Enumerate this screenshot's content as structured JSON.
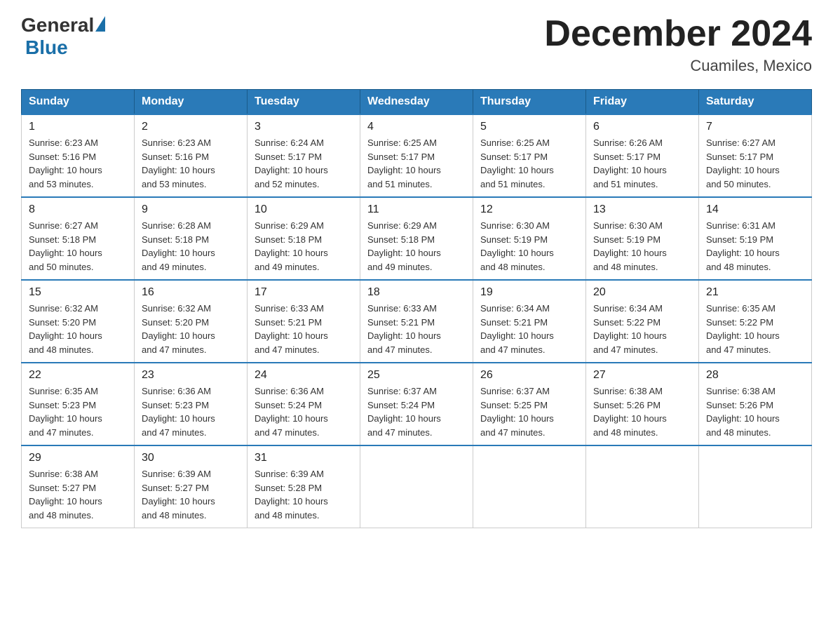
{
  "logo": {
    "general": "General",
    "blue": "Blue"
  },
  "title": "December 2024",
  "location": "Cuamiles, Mexico",
  "days_of_week": [
    "Sunday",
    "Monday",
    "Tuesday",
    "Wednesday",
    "Thursday",
    "Friday",
    "Saturday"
  ],
  "weeks": [
    [
      {
        "day": "1",
        "sunrise": "6:23 AM",
        "sunset": "5:16 PM",
        "daylight": "10 hours and 53 minutes."
      },
      {
        "day": "2",
        "sunrise": "6:23 AM",
        "sunset": "5:16 PM",
        "daylight": "10 hours and 53 minutes."
      },
      {
        "day": "3",
        "sunrise": "6:24 AM",
        "sunset": "5:17 PM",
        "daylight": "10 hours and 52 minutes."
      },
      {
        "day": "4",
        "sunrise": "6:25 AM",
        "sunset": "5:17 PM",
        "daylight": "10 hours and 51 minutes."
      },
      {
        "day": "5",
        "sunrise": "6:25 AM",
        "sunset": "5:17 PM",
        "daylight": "10 hours and 51 minutes."
      },
      {
        "day": "6",
        "sunrise": "6:26 AM",
        "sunset": "5:17 PM",
        "daylight": "10 hours and 51 minutes."
      },
      {
        "day": "7",
        "sunrise": "6:27 AM",
        "sunset": "5:17 PM",
        "daylight": "10 hours and 50 minutes."
      }
    ],
    [
      {
        "day": "8",
        "sunrise": "6:27 AM",
        "sunset": "5:18 PM",
        "daylight": "10 hours and 50 minutes."
      },
      {
        "day": "9",
        "sunrise": "6:28 AM",
        "sunset": "5:18 PM",
        "daylight": "10 hours and 49 minutes."
      },
      {
        "day": "10",
        "sunrise": "6:29 AM",
        "sunset": "5:18 PM",
        "daylight": "10 hours and 49 minutes."
      },
      {
        "day": "11",
        "sunrise": "6:29 AM",
        "sunset": "5:18 PM",
        "daylight": "10 hours and 49 minutes."
      },
      {
        "day": "12",
        "sunrise": "6:30 AM",
        "sunset": "5:19 PM",
        "daylight": "10 hours and 48 minutes."
      },
      {
        "day": "13",
        "sunrise": "6:30 AM",
        "sunset": "5:19 PM",
        "daylight": "10 hours and 48 minutes."
      },
      {
        "day": "14",
        "sunrise": "6:31 AM",
        "sunset": "5:19 PM",
        "daylight": "10 hours and 48 minutes."
      }
    ],
    [
      {
        "day": "15",
        "sunrise": "6:32 AM",
        "sunset": "5:20 PM",
        "daylight": "10 hours and 48 minutes."
      },
      {
        "day": "16",
        "sunrise": "6:32 AM",
        "sunset": "5:20 PM",
        "daylight": "10 hours and 47 minutes."
      },
      {
        "day": "17",
        "sunrise": "6:33 AM",
        "sunset": "5:21 PM",
        "daylight": "10 hours and 47 minutes."
      },
      {
        "day": "18",
        "sunrise": "6:33 AM",
        "sunset": "5:21 PM",
        "daylight": "10 hours and 47 minutes."
      },
      {
        "day": "19",
        "sunrise": "6:34 AM",
        "sunset": "5:21 PM",
        "daylight": "10 hours and 47 minutes."
      },
      {
        "day": "20",
        "sunrise": "6:34 AM",
        "sunset": "5:22 PM",
        "daylight": "10 hours and 47 minutes."
      },
      {
        "day": "21",
        "sunrise": "6:35 AM",
        "sunset": "5:22 PM",
        "daylight": "10 hours and 47 minutes."
      }
    ],
    [
      {
        "day": "22",
        "sunrise": "6:35 AM",
        "sunset": "5:23 PM",
        "daylight": "10 hours and 47 minutes."
      },
      {
        "day": "23",
        "sunrise": "6:36 AM",
        "sunset": "5:23 PM",
        "daylight": "10 hours and 47 minutes."
      },
      {
        "day": "24",
        "sunrise": "6:36 AM",
        "sunset": "5:24 PM",
        "daylight": "10 hours and 47 minutes."
      },
      {
        "day": "25",
        "sunrise": "6:37 AM",
        "sunset": "5:24 PM",
        "daylight": "10 hours and 47 minutes."
      },
      {
        "day": "26",
        "sunrise": "6:37 AM",
        "sunset": "5:25 PM",
        "daylight": "10 hours and 47 minutes."
      },
      {
        "day": "27",
        "sunrise": "6:38 AM",
        "sunset": "5:26 PM",
        "daylight": "10 hours and 48 minutes."
      },
      {
        "day": "28",
        "sunrise": "6:38 AM",
        "sunset": "5:26 PM",
        "daylight": "10 hours and 48 minutes."
      }
    ],
    [
      {
        "day": "29",
        "sunrise": "6:38 AM",
        "sunset": "5:27 PM",
        "daylight": "10 hours and 48 minutes."
      },
      {
        "day": "30",
        "sunrise": "6:39 AM",
        "sunset": "5:27 PM",
        "daylight": "10 hours and 48 minutes."
      },
      {
        "day": "31",
        "sunrise": "6:39 AM",
        "sunset": "5:28 PM",
        "daylight": "10 hours and 48 minutes."
      },
      null,
      null,
      null,
      null
    ]
  ],
  "labels": {
    "sunrise": "Sunrise:",
    "sunset": "Sunset:",
    "daylight": "Daylight:"
  },
  "colors": {
    "header_bg": "#2a7ab8",
    "header_text": "#ffffff",
    "border_top": "#2a7ab8",
    "title_color": "#222222",
    "logo_blue": "#1a6fa8"
  }
}
